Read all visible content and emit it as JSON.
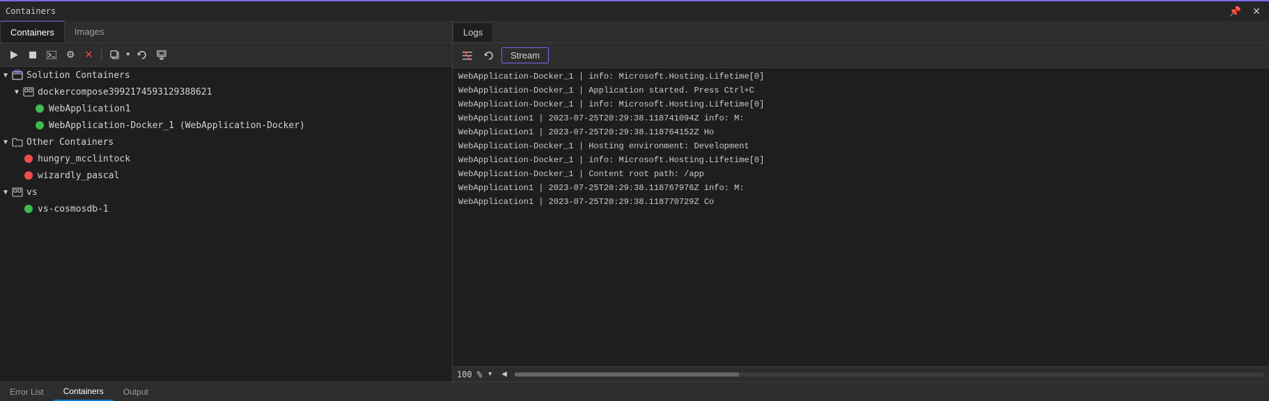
{
  "titleBar": {
    "title": "Containers",
    "pinIcon": "📌",
    "closeIcon": "✕"
  },
  "leftPanel": {
    "tabs": [
      {
        "id": "containers",
        "label": "Containers",
        "active": true
      },
      {
        "id": "images",
        "label": "Images",
        "active": false
      }
    ],
    "toolbar": {
      "startBtn": "▶",
      "stopBtn": "■",
      "attachBtn": "⬜",
      "settingsBtn": "⚙",
      "deleteBtn": "✕",
      "copyBtn": "⧉",
      "dropdownArrow": "▾",
      "refreshBtn": "↺",
      "pullBtn": "⬇"
    },
    "tree": {
      "sections": [
        {
          "id": "solution-containers",
          "label": "Solution Containers",
          "expanded": true,
          "icon": "solution",
          "children": [
            {
              "id": "dockercompose",
              "label": "dockercompose3992174593129388621",
              "expanded": true,
              "icon": "compose",
              "indent": 1,
              "children": [
                {
                  "id": "webapp1",
                  "label": "WebApplication1",
                  "status": "green",
                  "indent": 2
                },
                {
                  "id": "webapp-docker",
                  "label": "WebApplication-Docker_1 (WebApplication-Docker)",
                  "status": "green",
                  "indent": 2
                }
              ]
            }
          ]
        },
        {
          "id": "other-containers",
          "label": "Other Containers",
          "expanded": true,
          "icon": "folder",
          "children": [
            {
              "id": "hungry",
              "label": "hungry_mcclintock",
              "status": "red",
              "indent": 1
            },
            {
              "id": "wizardly",
              "label": "wizardly_pascal",
              "status": "red",
              "indent": 1
            }
          ]
        },
        {
          "id": "vs",
          "label": "vs",
          "expanded": true,
          "icon": "compose",
          "children": [
            {
              "id": "vscosmosdb",
              "label": "vs-cosmosdb-1",
              "status": "green",
              "indent": 1
            }
          ]
        }
      ]
    }
  },
  "rightPanel": {
    "tabLabel": "Logs",
    "toolbar": {
      "clearIcon": "⊘",
      "refreshIcon": "↺",
      "streamBtnLabel": "Stream"
    },
    "logLines": [
      "WebApplication-Docker_1  |  info: Microsoft.Hosting.Lifetime[0]",
      "WebApplication-Docker_1  |       Application started. Press Ctrl+C",
      "WebApplication-Docker_1  |  info: Microsoft.Hosting.Lifetime[0]",
      "WebApplication1          |  2023-07-25T20:29:38.118741094Z info: M:",
      "WebApplication1          |  2023-07-25T20:29:38.118764152Z         Ho",
      "WebApplication-Docker_1  |       Hosting environment: Development",
      "WebApplication-Docker_1  |  info: Microsoft.Hosting.Lifetime[0]",
      "WebApplication-Docker_1  |       Content root path: /app",
      "WebApplication1          |  2023-07-25T20:29:38.118767976Z info: M:",
      "WebApplication1          |  2023-07-25T20:29:38.118770729Z         Co"
    ],
    "zoomLevel": "100 %"
  },
  "bottomBar": {
    "tabs": [
      {
        "id": "error-list",
        "label": "Error List",
        "active": false
      },
      {
        "id": "containers",
        "label": "Containers",
        "active": true
      },
      {
        "id": "output",
        "label": "Output",
        "active": false
      }
    ]
  }
}
